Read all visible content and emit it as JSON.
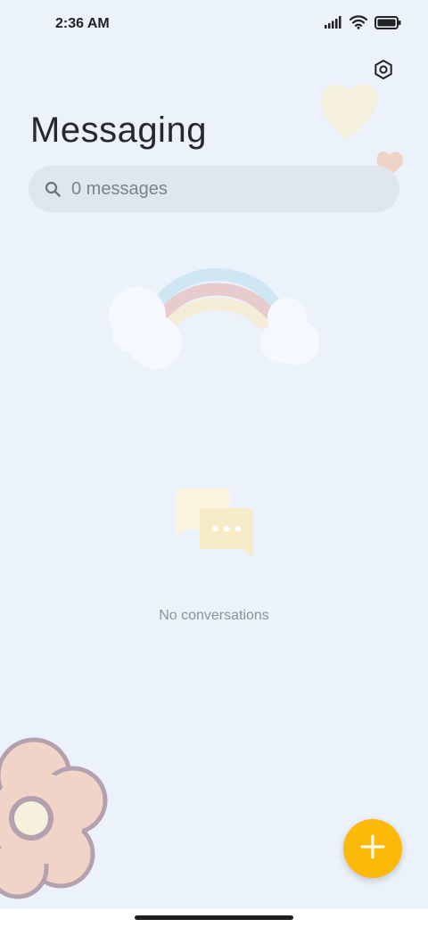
{
  "status_bar": {
    "time": "2:36 AM",
    "icons": [
      "signal-icon",
      "wifi-icon",
      "battery-icon"
    ]
  },
  "header": {
    "title": "Messaging",
    "settings_icon": "settings-icon"
  },
  "search": {
    "placeholder": "0 messages",
    "icon": "search-icon"
  },
  "empty_state": {
    "message": "No conversations",
    "icon": "chat-bubbles-icon"
  },
  "fab": {
    "icon": "plus-icon",
    "color": "#fbb909"
  },
  "theme": {
    "background": "#ebf2fc",
    "accent": "#fbb909",
    "decorations": [
      "heart-decoration",
      "rainbow-decoration",
      "flower-decoration"
    ]
  }
}
